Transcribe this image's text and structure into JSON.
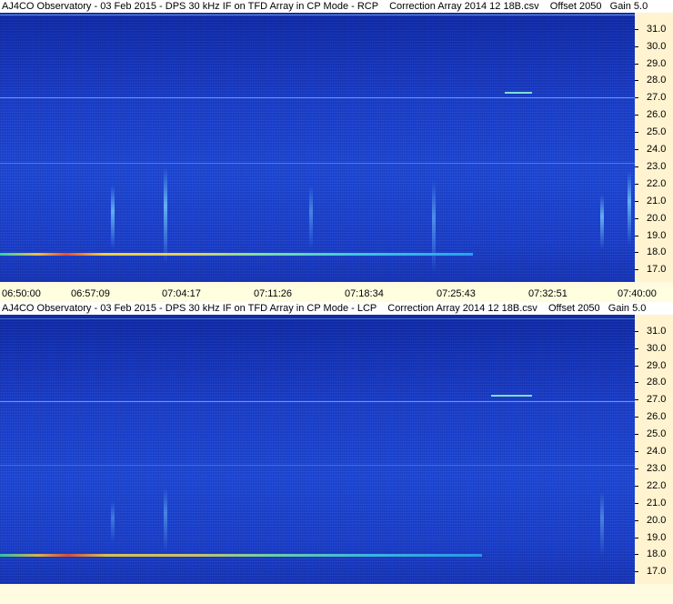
{
  "colors": {
    "background": "#fffbe0",
    "axis_background": "#fff3d0",
    "spectrogram_base": "#1a3fcc",
    "signal_line": "#e0d060"
  },
  "panels": [
    {
      "title": "AJ4CO Observatory - 03 Feb 2015 - DPS 30 kHz IF on TFD Array in CP Mode - RCP    Correction Array 2014 12 18B.csv    Offset 2050   Gain 5.0",
      "frequency_labels": [
        "31.0",
        "30.0",
        "29.0",
        "28.0",
        "27.0",
        "26.0",
        "25.0",
        "24.0",
        "23.0",
        "22.0",
        "21.0",
        "20.0",
        "19.0",
        "18.0",
        "17.0"
      ]
    },
    {
      "title": "AJ4CO Observatory - 03 Feb 2015 - DPS 30 kHz IF on TFD Array in CP Mode - LCP    Correction Array 2014 12 18B.csv    Offset 2050   Gain 5.0",
      "frequency_labels": [
        "31.0",
        "30.0",
        "29.0",
        "28.0",
        "27.0",
        "26.0",
        "25.0",
        "24.0",
        "23.0",
        "22.0",
        "21.0",
        "20.0",
        "19.0",
        "18.0",
        "17.0"
      ]
    }
  ],
  "time_axis": [
    "06:50:00",
    "06:57:09",
    "07:04:17",
    "07:11:26",
    "07:18:34",
    "07:25:43",
    "07:32:51",
    "07:40:00"
  ]
}
